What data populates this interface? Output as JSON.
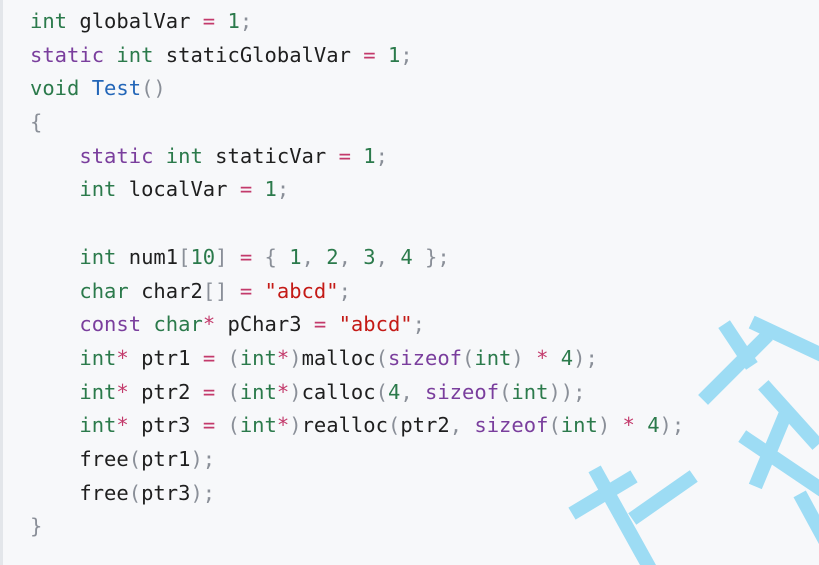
{
  "colors": {
    "background": "#f7f8fa",
    "keyword": "#7a3e9d",
    "type": "#2b7a4b",
    "function": "#2366b8",
    "number": "#2b7a4b",
    "string": "#c41a16",
    "punctuation": "#8a8f98",
    "operator": "#c33a6b",
    "identifier": "#1f1f1f",
    "watermark": "#7fd3f3"
  },
  "watermark_text": "比课",
  "code_lines": [
    [
      {
        "c": "t",
        "v": "int"
      },
      {
        "c": "id",
        "v": " globalVar "
      },
      {
        "c": "op",
        "v": "="
      },
      {
        "c": "id",
        "v": " "
      },
      {
        "c": "num",
        "v": "1"
      },
      {
        "c": "p",
        "v": ";"
      }
    ],
    [
      {
        "c": "k",
        "v": "static"
      },
      {
        "c": "id",
        "v": " "
      },
      {
        "c": "t",
        "v": "int"
      },
      {
        "c": "id",
        "v": " staticGlobalVar "
      },
      {
        "c": "op",
        "v": "="
      },
      {
        "c": "id",
        "v": " "
      },
      {
        "c": "num",
        "v": "1"
      },
      {
        "c": "p",
        "v": ";"
      }
    ],
    [
      {
        "c": "t",
        "v": "void"
      },
      {
        "c": "id",
        "v": " "
      },
      {
        "c": "fn",
        "v": "Test"
      },
      {
        "c": "p",
        "v": "()"
      }
    ],
    [
      {
        "c": "p",
        "v": "{"
      }
    ],
    [
      {
        "c": "id",
        "v": "    "
      },
      {
        "c": "k",
        "v": "static"
      },
      {
        "c": "id",
        "v": " "
      },
      {
        "c": "t",
        "v": "int"
      },
      {
        "c": "id",
        "v": " staticVar "
      },
      {
        "c": "op",
        "v": "="
      },
      {
        "c": "id",
        "v": " "
      },
      {
        "c": "num",
        "v": "1"
      },
      {
        "c": "p",
        "v": ";"
      }
    ],
    [
      {
        "c": "id",
        "v": "    "
      },
      {
        "c": "t",
        "v": "int"
      },
      {
        "c": "id",
        "v": " localVar "
      },
      {
        "c": "op",
        "v": "="
      },
      {
        "c": "id",
        "v": " "
      },
      {
        "c": "num",
        "v": "1"
      },
      {
        "c": "p",
        "v": ";"
      }
    ],
    [],
    [
      {
        "c": "id",
        "v": "    "
      },
      {
        "c": "t",
        "v": "int"
      },
      {
        "c": "id",
        "v": " num1"
      },
      {
        "c": "p",
        "v": "["
      },
      {
        "c": "num",
        "v": "10"
      },
      {
        "c": "p",
        "v": "]"
      },
      {
        "c": "id",
        "v": " "
      },
      {
        "c": "op",
        "v": "="
      },
      {
        "c": "id",
        "v": " "
      },
      {
        "c": "p",
        "v": "{"
      },
      {
        "c": "id",
        "v": " "
      },
      {
        "c": "num",
        "v": "1"
      },
      {
        "c": "p",
        "v": ","
      },
      {
        "c": "id",
        "v": " "
      },
      {
        "c": "num",
        "v": "2"
      },
      {
        "c": "p",
        "v": ","
      },
      {
        "c": "id",
        "v": " "
      },
      {
        "c": "num",
        "v": "3"
      },
      {
        "c": "p",
        "v": ","
      },
      {
        "c": "id",
        "v": " "
      },
      {
        "c": "num",
        "v": "4"
      },
      {
        "c": "id",
        "v": " "
      },
      {
        "c": "p",
        "v": "};"
      }
    ],
    [
      {
        "c": "id",
        "v": "    "
      },
      {
        "c": "t",
        "v": "char"
      },
      {
        "c": "id",
        "v": " char2"
      },
      {
        "c": "p",
        "v": "[]"
      },
      {
        "c": "id",
        "v": " "
      },
      {
        "c": "op",
        "v": "="
      },
      {
        "c": "id",
        "v": " "
      },
      {
        "c": "str",
        "v": "\"abcd\""
      },
      {
        "c": "p",
        "v": ";"
      }
    ],
    [
      {
        "c": "id",
        "v": "    "
      },
      {
        "c": "k",
        "v": "const"
      },
      {
        "c": "id",
        "v": " "
      },
      {
        "c": "t",
        "v": "char"
      },
      {
        "c": "op",
        "v": "*"
      },
      {
        "c": "id",
        "v": " pChar3 "
      },
      {
        "c": "op",
        "v": "="
      },
      {
        "c": "id",
        "v": " "
      },
      {
        "c": "str",
        "v": "\"abcd\""
      },
      {
        "c": "p",
        "v": ";"
      }
    ],
    [
      {
        "c": "id",
        "v": "    "
      },
      {
        "c": "t",
        "v": "int"
      },
      {
        "c": "op",
        "v": "*"
      },
      {
        "c": "id",
        "v": " ptr1 "
      },
      {
        "c": "op",
        "v": "="
      },
      {
        "c": "id",
        "v": " "
      },
      {
        "c": "p",
        "v": "("
      },
      {
        "c": "t",
        "v": "int"
      },
      {
        "c": "op",
        "v": "*"
      },
      {
        "c": "p",
        "v": ")"
      },
      {
        "c": "id",
        "v": "malloc"
      },
      {
        "c": "p",
        "v": "("
      },
      {
        "c": "k",
        "v": "sizeof"
      },
      {
        "c": "p",
        "v": "("
      },
      {
        "c": "t",
        "v": "int"
      },
      {
        "c": "p",
        "v": ")"
      },
      {
        "c": "id",
        "v": " "
      },
      {
        "c": "op",
        "v": "*"
      },
      {
        "c": "id",
        "v": " "
      },
      {
        "c": "num",
        "v": "4"
      },
      {
        "c": "p",
        "v": ");"
      }
    ],
    [
      {
        "c": "id",
        "v": "    "
      },
      {
        "c": "t",
        "v": "int"
      },
      {
        "c": "op",
        "v": "*"
      },
      {
        "c": "id",
        "v": " ptr2 "
      },
      {
        "c": "op",
        "v": "="
      },
      {
        "c": "id",
        "v": " "
      },
      {
        "c": "p",
        "v": "("
      },
      {
        "c": "t",
        "v": "int"
      },
      {
        "c": "op",
        "v": "*"
      },
      {
        "c": "p",
        "v": ")"
      },
      {
        "c": "id",
        "v": "calloc"
      },
      {
        "c": "p",
        "v": "("
      },
      {
        "c": "num",
        "v": "4"
      },
      {
        "c": "p",
        "v": ","
      },
      {
        "c": "id",
        "v": " "
      },
      {
        "c": "k",
        "v": "sizeof"
      },
      {
        "c": "p",
        "v": "("
      },
      {
        "c": "t",
        "v": "int"
      },
      {
        "c": "p",
        "v": "));"
      }
    ],
    [
      {
        "c": "id",
        "v": "    "
      },
      {
        "c": "t",
        "v": "int"
      },
      {
        "c": "op",
        "v": "*"
      },
      {
        "c": "id",
        "v": " ptr3 "
      },
      {
        "c": "op",
        "v": "="
      },
      {
        "c": "id",
        "v": " "
      },
      {
        "c": "p",
        "v": "("
      },
      {
        "c": "t",
        "v": "int"
      },
      {
        "c": "op",
        "v": "*"
      },
      {
        "c": "p",
        "v": ")"
      },
      {
        "c": "id",
        "v": "realloc"
      },
      {
        "c": "p",
        "v": "("
      },
      {
        "c": "id",
        "v": "ptr2"
      },
      {
        "c": "p",
        "v": ","
      },
      {
        "c": "id",
        "v": " "
      },
      {
        "c": "k",
        "v": "sizeof"
      },
      {
        "c": "p",
        "v": "("
      },
      {
        "c": "t",
        "v": "int"
      },
      {
        "c": "p",
        "v": ")"
      },
      {
        "c": "id",
        "v": " "
      },
      {
        "c": "op",
        "v": "*"
      },
      {
        "c": "id",
        "v": " "
      },
      {
        "c": "num",
        "v": "4"
      },
      {
        "c": "p",
        "v": ");"
      }
    ],
    [
      {
        "c": "id",
        "v": "    free"
      },
      {
        "c": "p",
        "v": "("
      },
      {
        "c": "id",
        "v": "ptr1"
      },
      {
        "c": "p",
        "v": ");"
      }
    ],
    [
      {
        "c": "id",
        "v": "    free"
      },
      {
        "c": "p",
        "v": "("
      },
      {
        "c": "id",
        "v": "ptr3"
      },
      {
        "c": "p",
        "v": ");"
      }
    ],
    [
      {
        "c": "p",
        "v": "}"
      }
    ]
  ]
}
